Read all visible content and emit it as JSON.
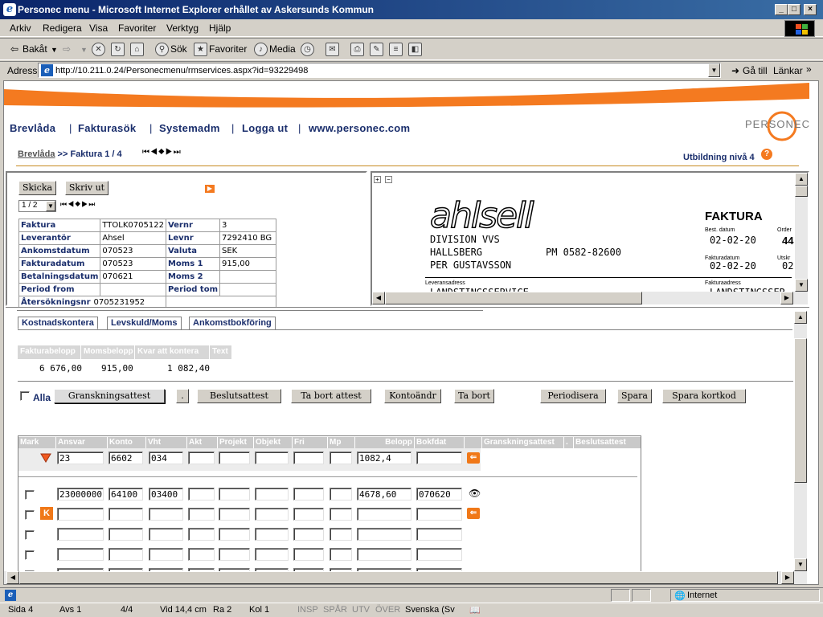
{
  "window": {
    "title": "Personec menu - Microsoft Internet Explorer erhållet av Askersunds Kommun",
    "min": "_",
    "max": "□",
    "close": "×"
  },
  "menu": [
    "Arkiv",
    "Redigera",
    "Visa",
    "Favoriter",
    "Verktyg",
    "Hjälp"
  ],
  "toolbar": {
    "back": "Bakåt",
    "search": "Sök",
    "favorites": "Favoriter",
    "media": "Media"
  },
  "address": {
    "label": "Adress",
    "url": "http://10.211.0.24/Personecmenu/rmservices.aspx?id=93229498",
    "go": "Gå till",
    "links": "Länkar"
  },
  "nav": {
    "items": [
      "Brevlåda",
      "Fakturasök",
      "Systemadm",
      "Logga ut",
      "www.personec.com"
    ],
    "brand": "PERSONEC"
  },
  "breadcrumb": {
    "link": "Brevlåda",
    "sep": ">>",
    "current": "Faktura 1 / 4"
  },
  "level": "Utbildning nivå 4",
  "invoice_panel": {
    "send": "Skicka",
    "print": "Skriv ut",
    "pager": "1 / 2",
    "rows": [
      [
        "Faktura",
        "TTOLK0705122",
        "Vernr",
        "3"
      ],
      [
        "Leverantör",
        "Ahsel",
        "Levnr",
        "7292410 BG"
      ],
      [
        "Ankomstdatum",
        "070523",
        "Valuta",
        "SEK"
      ],
      [
        "Fakturadatum",
        "070523",
        "Moms 1",
        "915,00"
      ],
      [
        "Betalningsdatum",
        "070621",
        "Moms 2",
        ""
      ],
      [
        "Period from",
        "",
        "Period tom",
        ""
      ]
    ],
    "lastrow_label": "Återsökningsnr",
    "lastrow_value": "0705231952"
  },
  "preview": {
    "logo": "ahlsell",
    "line1": "DIVISION VVS",
    "line2": "HALLSBERG",
    "phone": "PM 0582-82600",
    "line3": "PER GUSTAVSSON",
    "small1": "Leveransadress",
    "big1": "LANDSTINGSSERVICE",
    "doc": "FAKTURA",
    "bdatum_lbl": "Best. datum",
    "bdatum": "02-02-20",
    "order_lbl": "Order",
    "order": "44",
    "fdatum_lbl": "Fakturadatum",
    "fdatum": "02-02-20",
    "utskr_lbl": "Utskr",
    "utskr": "02",
    "fadr_lbl": "Fakturaadress",
    "fadr": "LANDSTINGSSER"
  },
  "tabs": [
    "Kostnadskontera",
    "Levskuld/Moms",
    "Ankomstbokföring"
  ],
  "summary": {
    "headers": [
      "Fakturabelopp",
      "Momsbelopp",
      "Kvar att kontera",
      "Text"
    ],
    "values": [
      "6 676,00",
      "915,00",
      "1 082,40",
      ""
    ]
  },
  "actions": {
    "all": "Alla",
    "granskning": "Granskningsattest",
    "dot": ".",
    "beslut": "Beslutsattest",
    "tabort_attest": "Ta bort attest",
    "kontoandr": "Kontoändr",
    "tabort": "Ta bort",
    "periodisera": "Periodisera",
    "spara": "Spara",
    "spara_kortkod": "Spara kortkod"
  },
  "grid": {
    "headers": [
      "Mark",
      "Ansvar",
      "Konto",
      "Vht",
      "Akt",
      "Projekt",
      "Objekt",
      "Fri",
      "Mp",
      "Belopp",
      "Bokfdat",
      "",
      "Granskningsattest",
      ".",
      "Beslutsattest"
    ],
    "edit_row": {
      "ansvar": "23",
      "konto": "6602",
      "vht": "034",
      "akt": "",
      "belopp": "1082,4"
    },
    "rows": [
      {
        "ansvar": "23000000",
        "konto": "64100",
        "vht": "03400",
        "belopp": "4678,60",
        "bokfdat": "070620"
      }
    ]
  },
  "statusbar": {
    "zone": "Internet"
  },
  "bottom": {
    "sida": "Sida  4",
    "avs": "Avs  1",
    "pages": "4/4",
    "vid": "Vid  14,4 cm",
    "ra": "Ra  2",
    "kol": "Kol  1",
    "insp": "INSP",
    "spar": "SPÅR",
    "utv": "UTV",
    "over": "ÖVER",
    "lang": "Svenska (Sv"
  }
}
